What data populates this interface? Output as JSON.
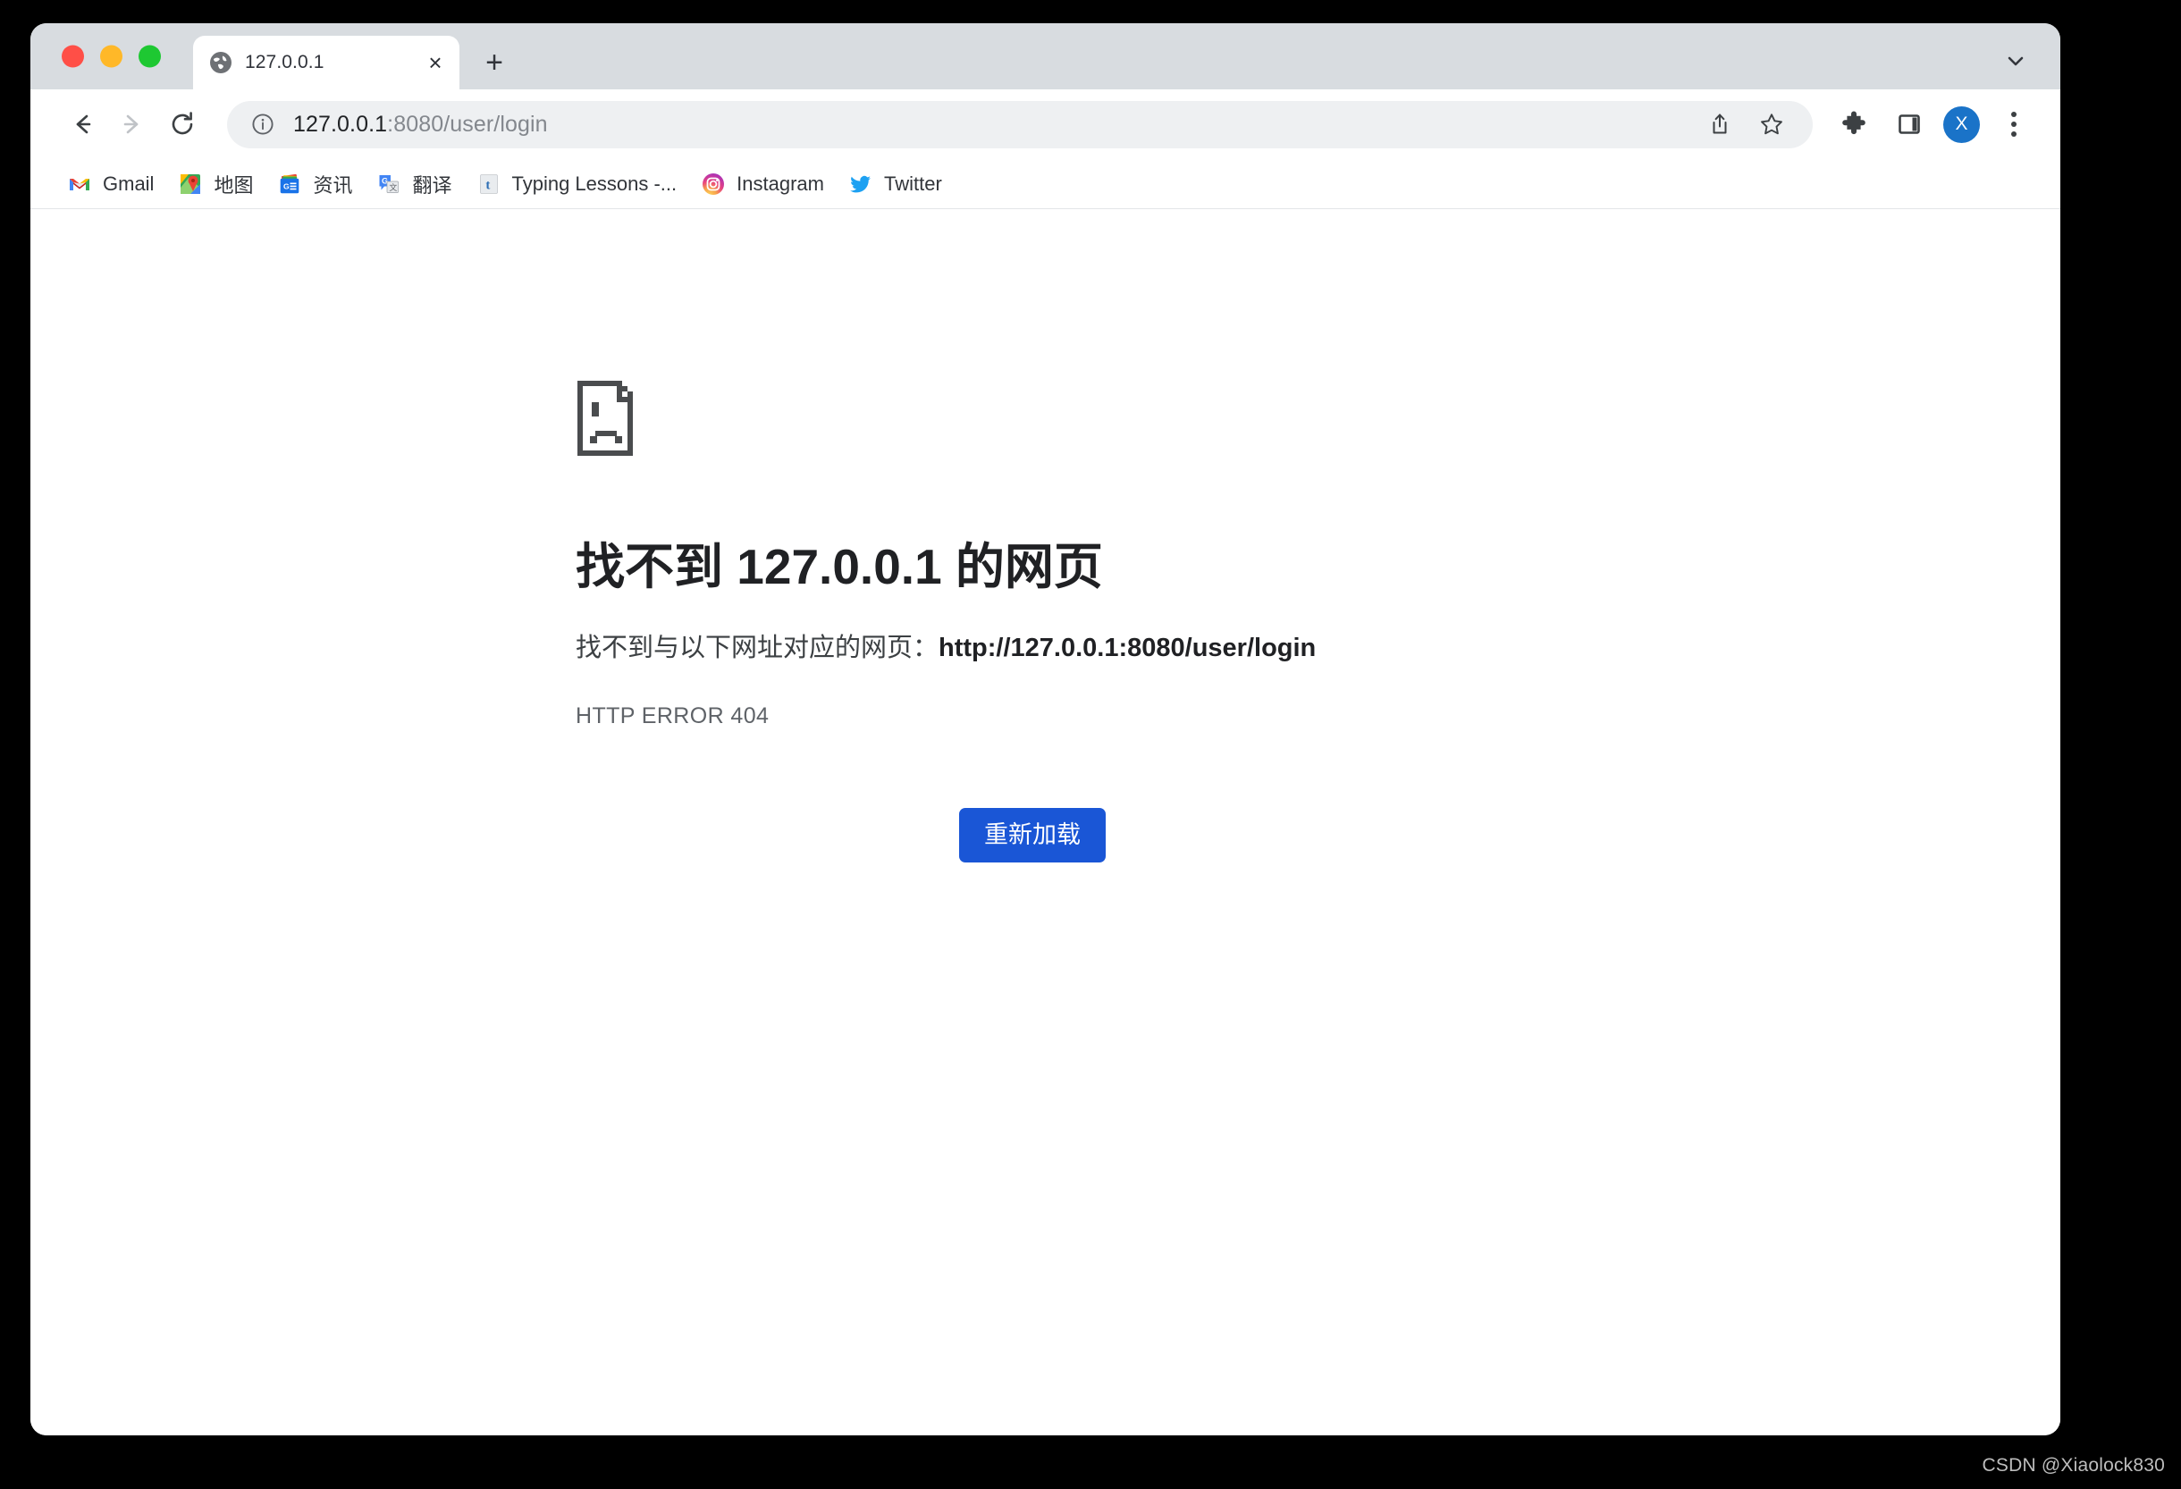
{
  "window": {
    "traffic_lights": [
      {
        "name": "close",
        "color": "#ff4f47"
      },
      {
        "name": "minimize",
        "color": "#ffb828"
      },
      {
        "name": "maximize",
        "color": "#1ec832"
      }
    ]
  },
  "tabstrip": {
    "tab": {
      "title": "127.0.0.1",
      "favicon": "globe-icon",
      "close_label": "×"
    },
    "new_tab_label": "+",
    "tab_search_icon": "chevron-down-icon"
  },
  "toolbar": {
    "back_icon": "arrow-left-icon",
    "forward_icon": "arrow-right-icon",
    "reload_icon": "reload-icon",
    "site_info_icon": "info-circle-icon",
    "url_primary": "127.0.0.1",
    "url_secondary": ":8080/user/login",
    "url_full": "127.0.0.1:8080/user/login",
    "share_icon": "share-icon",
    "bookmark_icon": "star-outline-icon",
    "extensions_icon": "puzzle-piece-icon",
    "side_panel_icon": "side-panel-icon",
    "profile_initial": "X",
    "profile_color": "#1a73c8",
    "menu_icon": "three-dots-vertical-icon"
  },
  "bookmarks": [
    {
      "label": "Gmail",
      "icon": "gmail-icon"
    },
    {
      "label": "地图",
      "icon": "google-maps-icon"
    },
    {
      "label": "资讯",
      "icon": "google-news-icon"
    },
    {
      "label": "翻译",
      "icon": "google-translate-icon"
    },
    {
      "label": "Typing Lessons -...",
      "icon": "typing-lessons-icon"
    },
    {
      "label": "Instagram",
      "icon": "instagram-icon"
    },
    {
      "label": "Twitter",
      "icon": "twitter-icon"
    }
  ],
  "error_page": {
    "icon": "sad-document-icon",
    "heading": "找不到 127.0.0.1 的网页",
    "subtitle_prefix": "找不到与以下网址对应的网页：",
    "subtitle_url": "http://127.0.0.1:8080/user/login",
    "error_code": "HTTP ERROR 404",
    "reload_button_label": "重新加载",
    "reload_button_color": "#1a56d6"
  },
  "watermark": {
    "text": "CSDN @Xiaolock830"
  }
}
